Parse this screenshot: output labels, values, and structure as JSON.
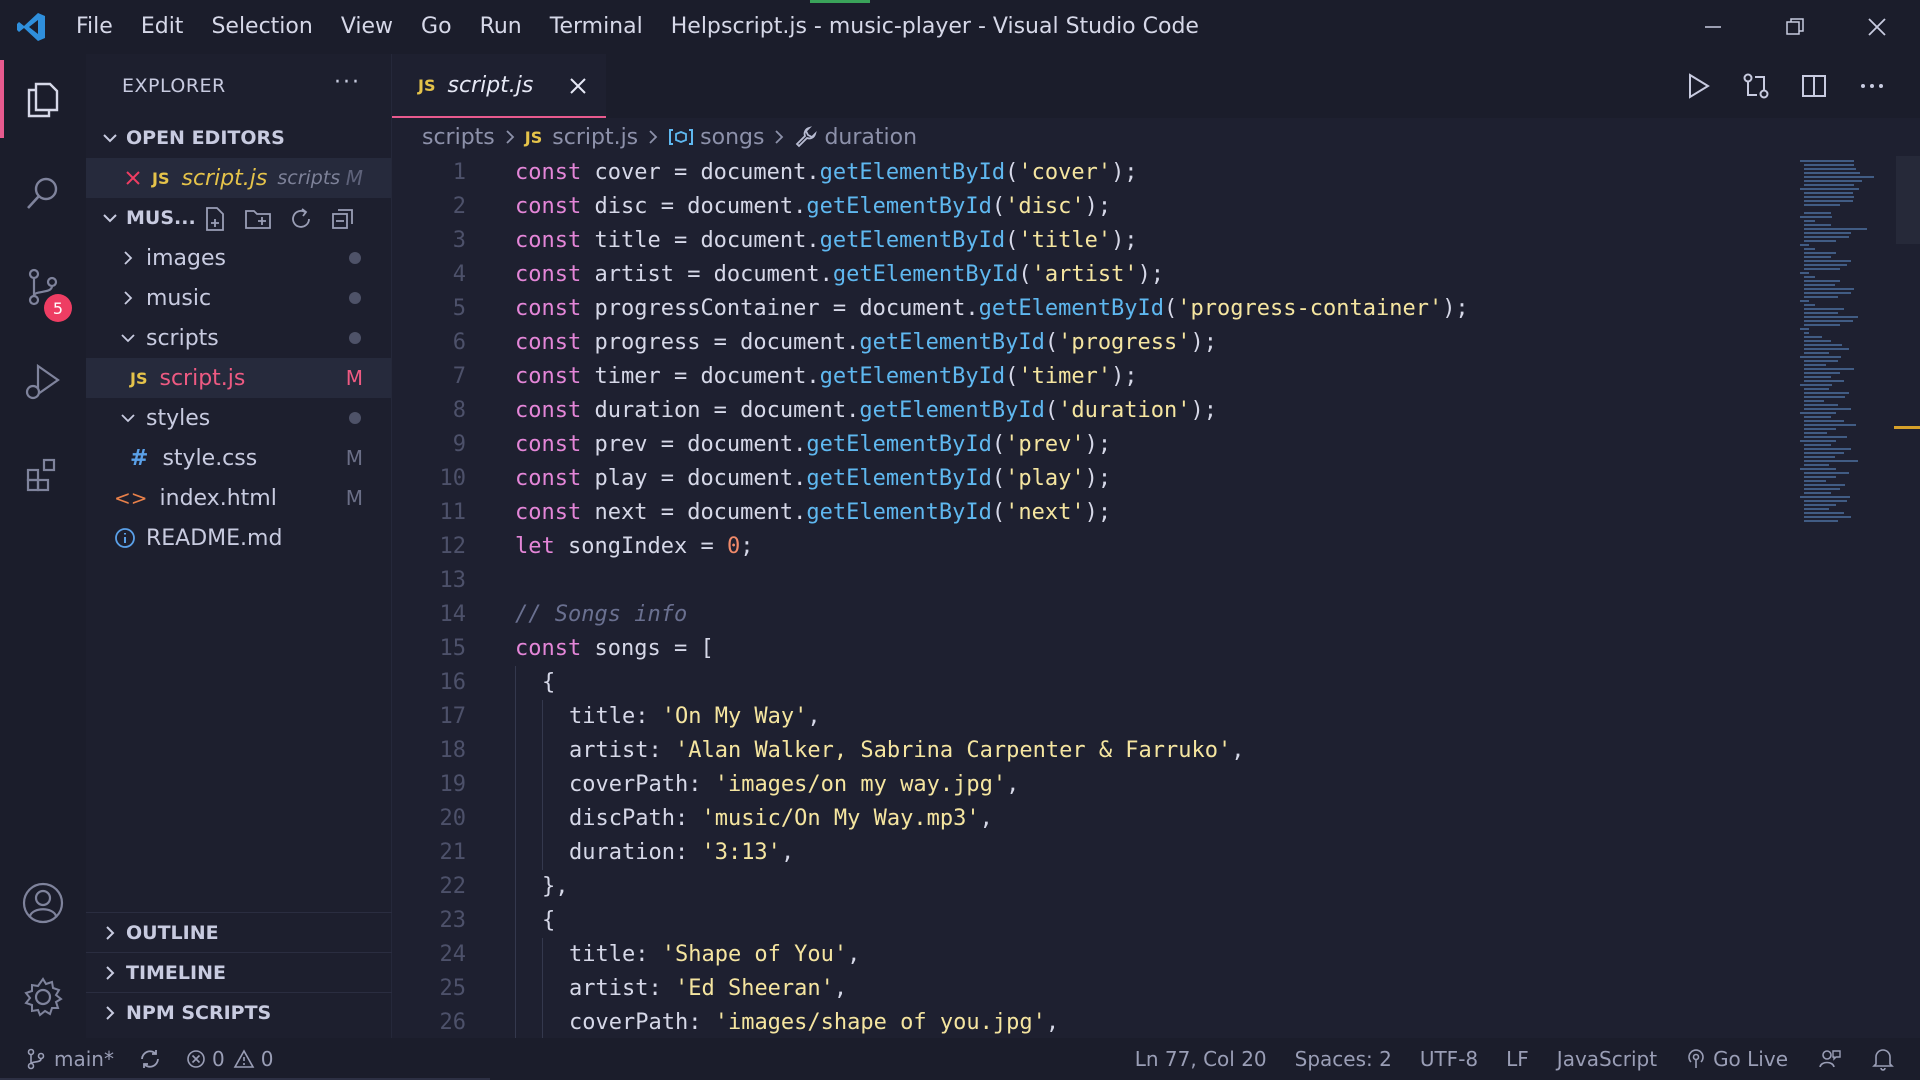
{
  "window": {
    "title": "script.js - music-player - Visual Studio Code",
    "menu": [
      "File",
      "Edit",
      "Selection",
      "View",
      "Go",
      "Run",
      "Terminal",
      "Help"
    ]
  },
  "activity_bar": {
    "items": [
      "explorer-icon",
      "search-icon",
      "source-control-icon",
      "run-debug-icon",
      "extensions-icon"
    ],
    "source_control_badge": "5",
    "bottom": [
      "account-icon",
      "settings-icon"
    ]
  },
  "sidebar": {
    "title": "EXPLORER",
    "more": "···",
    "open_editors": {
      "label": "OPEN EDITORS",
      "items": [
        {
          "badge": "JS",
          "name": "script.js",
          "folder": "scripts",
          "status": "M"
        }
      ]
    },
    "workspace": {
      "label": "MUS...",
      "tree": [
        {
          "type": "folder",
          "name": "images",
          "expanded": false,
          "indent": 1
        },
        {
          "type": "folder",
          "name": "music",
          "expanded": false,
          "indent": 1
        },
        {
          "type": "folder",
          "name": "scripts",
          "expanded": true,
          "indent": 1
        },
        {
          "type": "js",
          "badge": "JS",
          "name": "script.js",
          "status": "M",
          "indent": 2
        },
        {
          "type": "folder",
          "name": "styles",
          "expanded": true,
          "indent": 1
        },
        {
          "type": "css",
          "badge": "#",
          "name": "style.css",
          "status": "M",
          "indent": 2
        },
        {
          "type": "html",
          "badge": "<>",
          "name": "index.html",
          "status": "M",
          "indent": 1
        },
        {
          "type": "info",
          "name": "README.md",
          "status": "",
          "indent": 1
        }
      ]
    },
    "bottom_sections": [
      "OUTLINE",
      "TIMELINE",
      "NPM SCRIPTS"
    ]
  },
  "editor": {
    "tab": {
      "badge": "JS",
      "label": "script.js"
    },
    "breadcrumb": {
      "folder": "scripts",
      "file_badge": "JS",
      "file": "script.js",
      "symbol1": "songs",
      "symbol2": "duration"
    },
    "lines": [
      {
        "n": "1",
        "indent": 0,
        "tokens": [
          [
            "kw",
            "const"
          ],
          [
            "pn",
            " cover = document."
          ],
          [
            "fn",
            "getElementById"
          ],
          [
            "pn",
            "("
          ],
          [
            "str",
            "'cover'"
          ],
          [
            "pn",
            ");"
          ]
        ]
      },
      {
        "n": "2",
        "indent": 0,
        "tokens": [
          [
            "kw",
            "const"
          ],
          [
            "pn",
            " disc = document."
          ],
          [
            "fn",
            "getElementById"
          ],
          [
            "pn",
            "("
          ],
          [
            "str",
            "'disc'"
          ],
          [
            "pn",
            ");"
          ]
        ]
      },
      {
        "n": "3",
        "indent": 0,
        "tokens": [
          [
            "kw",
            "const"
          ],
          [
            "pn",
            " title = document."
          ],
          [
            "fn",
            "getElementById"
          ],
          [
            "pn",
            "("
          ],
          [
            "str",
            "'title'"
          ],
          [
            "pn",
            ");"
          ]
        ]
      },
      {
        "n": "4",
        "indent": 0,
        "tokens": [
          [
            "kw",
            "const"
          ],
          [
            "pn",
            " artist = document."
          ],
          [
            "fn",
            "getElementById"
          ],
          [
            "pn",
            "("
          ],
          [
            "str",
            "'artist'"
          ],
          [
            "pn",
            ");"
          ]
        ]
      },
      {
        "n": "5",
        "indent": 0,
        "tokens": [
          [
            "kw",
            "const"
          ],
          [
            "pn",
            " progressContainer = document."
          ],
          [
            "fn",
            "getElementById"
          ],
          [
            "pn",
            "("
          ],
          [
            "str",
            "'progress-container'"
          ],
          [
            "pn",
            ");"
          ]
        ]
      },
      {
        "n": "6",
        "indent": 0,
        "tokens": [
          [
            "kw",
            "const"
          ],
          [
            "pn",
            " progress = document."
          ],
          [
            "fn",
            "getElementById"
          ],
          [
            "pn",
            "("
          ],
          [
            "str",
            "'progress'"
          ],
          [
            "pn",
            ");"
          ]
        ]
      },
      {
        "n": "7",
        "indent": 0,
        "tokens": [
          [
            "kw",
            "const"
          ],
          [
            "pn",
            " timer = document."
          ],
          [
            "fn",
            "getElementById"
          ],
          [
            "pn",
            "("
          ],
          [
            "str",
            "'timer'"
          ],
          [
            "pn",
            ");"
          ]
        ]
      },
      {
        "n": "8",
        "indent": 0,
        "tokens": [
          [
            "kw",
            "const"
          ],
          [
            "pn",
            " duration = document."
          ],
          [
            "fn",
            "getElementById"
          ],
          [
            "pn",
            "("
          ],
          [
            "str",
            "'duration'"
          ],
          [
            "pn",
            ");"
          ]
        ]
      },
      {
        "n": "9",
        "indent": 0,
        "tokens": [
          [
            "kw",
            "const"
          ],
          [
            "pn",
            " prev = document."
          ],
          [
            "fn",
            "getElementById"
          ],
          [
            "pn",
            "("
          ],
          [
            "str",
            "'prev'"
          ],
          [
            "pn",
            ");"
          ]
        ]
      },
      {
        "n": "10",
        "indent": 0,
        "tokens": [
          [
            "kw",
            "const"
          ],
          [
            "pn",
            " play = document."
          ],
          [
            "fn",
            "getElementById"
          ],
          [
            "pn",
            "("
          ],
          [
            "str",
            "'play'"
          ],
          [
            "pn",
            ");"
          ]
        ]
      },
      {
        "n": "11",
        "indent": 0,
        "tokens": [
          [
            "kw",
            "const"
          ],
          [
            "pn",
            " next = document."
          ],
          [
            "fn",
            "getElementById"
          ],
          [
            "pn",
            "("
          ],
          [
            "str",
            "'next'"
          ],
          [
            "pn",
            ");"
          ]
        ]
      },
      {
        "n": "12",
        "indent": 0,
        "tokens": [
          [
            "kw",
            "let"
          ],
          [
            "pn",
            " songIndex = "
          ],
          [
            "num",
            "0"
          ],
          [
            "pn",
            ";"
          ]
        ]
      },
      {
        "n": "13",
        "indent": 0,
        "tokens": []
      },
      {
        "n": "14",
        "indent": 0,
        "tokens": [
          [
            "cm",
            "// Songs info"
          ]
        ]
      },
      {
        "n": "15",
        "indent": 0,
        "tokens": [
          [
            "kw",
            "const"
          ],
          [
            "pn",
            " songs = ["
          ]
        ]
      },
      {
        "n": "16",
        "indent": 1,
        "tokens": [
          [
            "pn",
            "{"
          ]
        ]
      },
      {
        "n": "17",
        "indent": 2,
        "tokens": [
          [
            "pn",
            "title: "
          ],
          [
            "str",
            "'On My Way'"
          ],
          [
            "pn",
            ","
          ]
        ]
      },
      {
        "n": "18",
        "indent": 2,
        "tokens": [
          [
            "pn",
            "artist: "
          ],
          [
            "str",
            "'Alan Walker, Sabrina Carpenter & Farruko'"
          ],
          [
            "pn",
            ","
          ]
        ]
      },
      {
        "n": "19",
        "indent": 2,
        "tokens": [
          [
            "pn",
            "coverPath: "
          ],
          [
            "str",
            "'images/on my way.jpg'"
          ],
          [
            "pn",
            ","
          ]
        ]
      },
      {
        "n": "20",
        "indent": 2,
        "tokens": [
          [
            "pn",
            "discPath: "
          ],
          [
            "str",
            "'music/On My Way.mp3'"
          ],
          [
            "pn",
            ","
          ]
        ]
      },
      {
        "n": "21",
        "indent": 2,
        "tokens": [
          [
            "pn",
            "duration: "
          ],
          [
            "str",
            "'3:13'"
          ],
          [
            "pn",
            ","
          ]
        ]
      },
      {
        "n": "22",
        "indent": 1,
        "tokens": [
          [
            "pn",
            "},"
          ]
        ]
      },
      {
        "n": "23",
        "indent": 1,
        "tokens": [
          [
            "pn",
            "{"
          ]
        ]
      },
      {
        "n": "24",
        "indent": 2,
        "tokens": [
          [
            "pn",
            "title: "
          ],
          [
            "str",
            "'Shape of You'"
          ],
          [
            "pn",
            ","
          ]
        ]
      },
      {
        "n": "25",
        "indent": 2,
        "tokens": [
          [
            "pn",
            "artist: "
          ],
          [
            "str",
            "'Ed Sheeran'"
          ],
          [
            "pn",
            ","
          ]
        ]
      },
      {
        "n": "26",
        "indent": 2,
        "tokens": [
          [
            "pn",
            "coverPath: "
          ],
          [
            "str",
            "'images/shape of you.jpg'"
          ],
          [
            "pn",
            ","
          ]
        ]
      }
    ]
  },
  "statusbar": {
    "branch": "main*",
    "errors": "0",
    "warnings": "0",
    "position": "Ln 77, Col 20",
    "spaces": "Spaces: 2",
    "encoding": "UTF-8",
    "eol": "LF",
    "language": "JavaScript",
    "go_live": "Go Live"
  },
  "colors": {
    "accent": "#e85a8e",
    "keyword": "#e486d8",
    "function": "#5fb8f0",
    "string": "#f5e5a0",
    "number": "#f08a6a",
    "comment": "#6a7090",
    "modified": "#e5c34a",
    "badge": "#ee3d63"
  }
}
